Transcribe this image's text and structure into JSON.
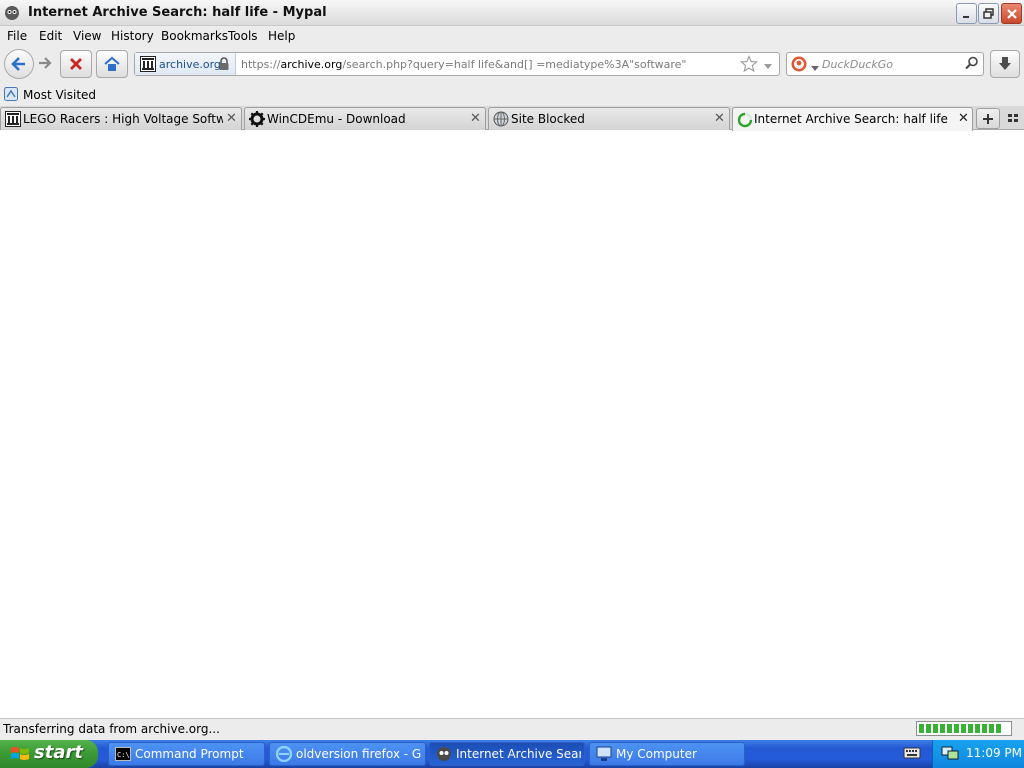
{
  "window": {
    "title": "Internet Archive Search: half life - Mypal"
  },
  "menu": [
    "File",
    "Edit",
    "View",
    "History",
    "Bookmarks",
    "Tools",
    "Help"
  ],
  "navigation": {
    "identity_label": "archive.org",
    "url_prefix": "https://",
    "url_domain": "archive.org",
    "url_path": "/search.php?query=half life&and[] =mediatype%3A\"software\"",
    "search_engine_placeholder": "DuckDuckGo"
  },
  "bookmarks": {
    "most_visited": "Most Visited"
  },
  "tabs": [
    {
      "label": "LEGO Racers : High Voltage Software, I..."
    },
    {
      "label": "WinCDEmu - Download"
    },
    {
      "label": "Site Blocked"
    },
    {
      "label": "Internet Archive Search: half life"
    }
  ],
  "status": {
    "text": "Transferring data from archive.org...",
    "progress": 0.9
  },
  "taskbar": {
    "start_label": "start",
    "tasks": [
      {
        "label": "Command Prompt"
      },
      {
        "label": "oldversion firefox - G..."
      },
      {
        "label": "Internet Archive Sear..."
      },
      {
        "label": "My Computer"
      }
    ],
    "clock": "11:09 PM"
  },
  "colors": {
    "taskbar_blue": "#245bd8",
    "start_green": "#3c9b35",
    "progress_green": "#38b137"
  }
}
